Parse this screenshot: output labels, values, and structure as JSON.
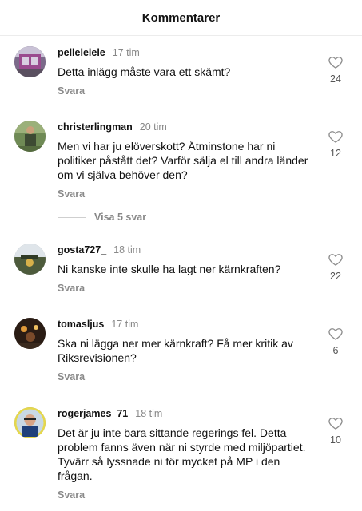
{
  "header": {
    "title": "Kommentarer"
  },
  "comments": [
    {
      "username": "pellelelele",
      "time": "17 tim",
      "text": "Detta inlägg måste vara ett skämt?",
      "reply_label": "Svara",
      "likes": "24",
      "avatar_icon": "avatar-photo"
    },
    {
      "username": "christerlingman",
      "time": "20 tim",
      "text": "Men vi har ju elöverskott? Åtminstone har ni politiker påstått det? Varför sälja el till andra länder om vi själva behöver den?",
      "reply_label": "Svara",
      "likes": "12",
      "avatar_icon": "avatar-photo"
    },
    {
      "username": "gosta727_",
      "time": "18 tim",
      "text": "Ni kanske inte skulle ha lagt ner kärnkraften?",
      "reply_label": "Svara",
      "likes": "22",
      "avatar_icon": "avatar-photo"
    },
    {
      "username": "tomasljus",
      "time": "17 tim",
      "text": "Ska ni lägga ner mer kärnkraft? Få mer kritik av Riksrevisionen?",
      "reply_label": "Svara",
      "likes": "6",
      "avatar_icon": "avatar-photo"
    },
    {
      "username": "rogerjames_71",
      "time": "18 tim",
      "text": "Det är ju inte bara sittande regerings fel. Detta problem fanns även  när ni styrde med miljöpartiet. Tyvärr så lyssnade ni för mycket på MP i den frågan.",
      "reply_label": "Svara",
      "likes": "10",
      "avatar_icon": "avatar-photo"
    }
  ],
  "view_replies": {
    "label": "Visa 5 svar"
  },
  "icons": {
    "like": "heart-outline-icon"
  },
  "colors": {
    "text": "#111111",
    "muted": "#888888",
    "divider": "#ececec"
  }
}
